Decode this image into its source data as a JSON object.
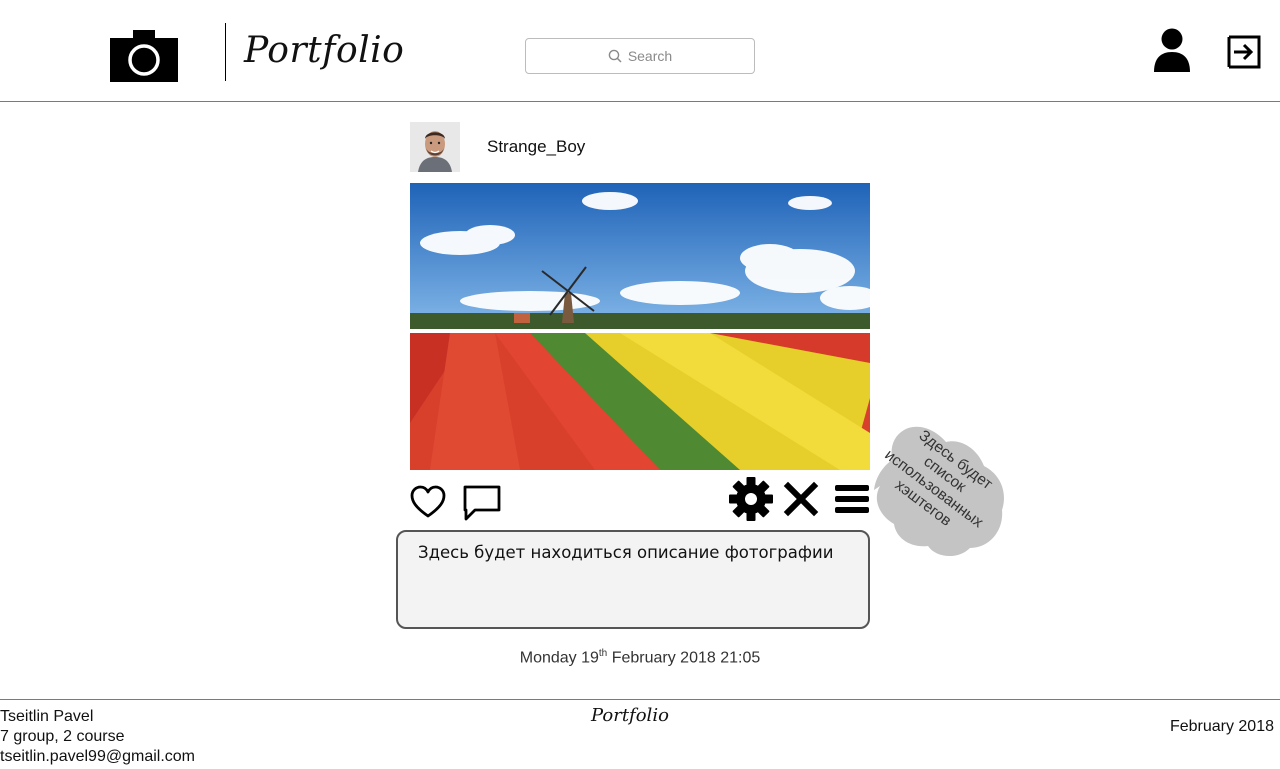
{
  "header": {
    "logo_text": "Portfolio",
    "search": {
      "placeholder": "Search"
    }
  },
  "post": {
    "username": "Strange_Boy",
    "description": "Здесь будет находиться описание фотографии",
    "hashtags_note": [
      "Здесь будет",
      "список",
      "использованных",
      "хэштегов"
    ],
    "date": {
      "day": "Monday 19",
      "suffix": "th",
      "rest": " February 2018 21:05"
    }
  },
  "footer": {
    "author": {
      "name": "Tseitlin Pavel",
      "group": "7 group, 2 course",
      "email": "tseitlin.pavel99@gmail.com"
    },
    "logo_text": "Portfolio",
    "date": "February 2018"
  },
  "icons": {
    "logo": "camera-icon",
    "search": "search-icon",
    "profile": "user-icon",
    "logout": "logout-icon",
    "like": "heart-icon",
    "comment": "comment-icon",
    "settings": "gear-icon",
    "delete": "close-icon",
    "menu": "menu-icon"
  },
  "colors": {
    "hashtag_blob": "#c4c4c4",
    "description_bg": "#f3f3f3"
  }
}
